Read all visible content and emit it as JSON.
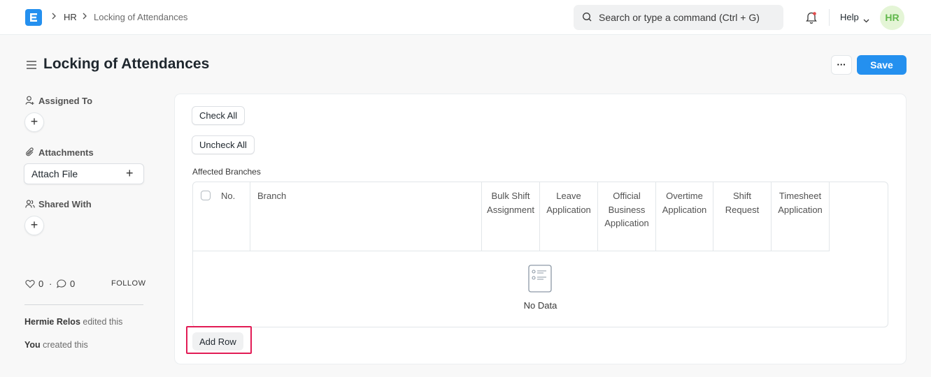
{
  "breadcrumb": {
    "module": "HR",
    "page": "Locking of Attendances"
  },
  "search": {
    "placeholder": "Search or type a command (Ctrl + G)"
  },
  "navbar": {
    "help_label": "Help",
    "avatar_initials": "HR"
  },
  "page": {
    "title": "Locking of Attendances",
    "more_label": "···",
    "save_label": "Save"
  },
  "sidebar": {
    "assigned_to_label": "Assigned To",
    "attachments_label": "Attachments",
    "attach_file_label": "Attach File",
    "shared_with_label": "Shared With",
    "like_count": "0",
    "comment_count": "0",
    "follow_label": "FOLLOW",
    "activity": [
      {
        "user": "Hermie Relos",
        "action": "edited this"
      },
      {
        "user": "You",
        "action": "created this"
      }
    ]
  },
  "form": {
    "check_all_label": "Check All",
    "uncheck_all_label": "Uncheck All",
    "affected_branches_label": "Affected Branches",
    "columns": [
      "No.",
      "Branch",
      "Bulk Shift Assignment",
      "Leave Application",
      "Official Business Application",
      "Overtime Application",
      "Shift Request",
      "Timesheet Application"
    ],
    "no_data_label": "No Data",
    "add_row_label": "Add Row"
  },
  "colors": {
    "accent": "#2490ef",
    "highlight": "#e21b55",
    "avatar_bg": "#e4f5d6",
    "avatar_fg": "#61b84c"
  }
}
